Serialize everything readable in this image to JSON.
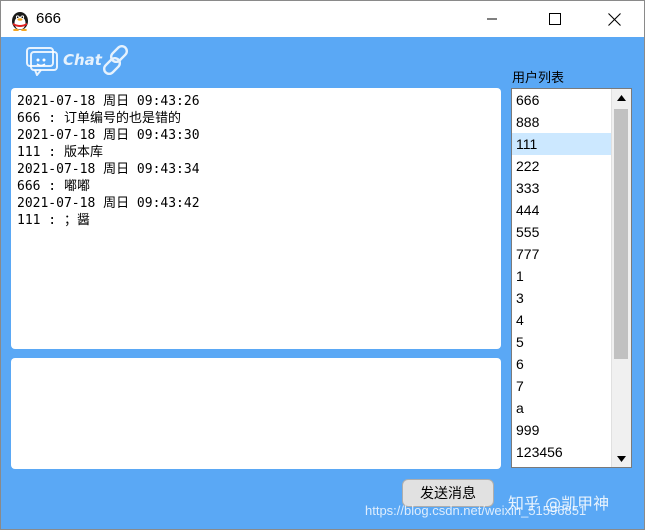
{
  "window": {
    "title": "666",
    "minimize_icon": "minimize-icon",
    "maximize_icon": "maximize-icon",
    "close_icon": "close-icon"
  },
  "logo": {
    "text": "Chat",
    "icon": "chat-bubble-icon",
    "link_icon": "link-icon"
  },
  "messages": [
    "2021-07-18 周日 09:43:26",
    "666 : 订单编号的也是错的",
    "2021-07-18 周日 09:43:30",
    "111 : 版本库",
    "2021-07-18 周日 09:43:34",
    "666 : 嘟嘟",
    "2021-07-18 周日 09:43:42",
    "111 : ；醤"
  ],
  "input": {
    "value": ""
  },
  "userlist": {
    "label": "用户列表",
    "selected": "111",
    "items": [
      "666",
      "888",
      "111",
      "222",
      "333",
      "444",
      "555",
      "777",
      "1",
      "3",
      "4",
      "5",
      "6",
      "7",
      "a",
      "999",
      "123456"
    ]
  },
  "send_button": {
    "label": "发送消息"
  },
  "watermark": {
    "zhihu": "知乎 @凯甲神",
    "url": "https://blog.csdn.net/weixin_51596851"
  },
  "colors": {
    "background": "#5aa8f5",
    "selected": "#cce8ff"
  }
}
